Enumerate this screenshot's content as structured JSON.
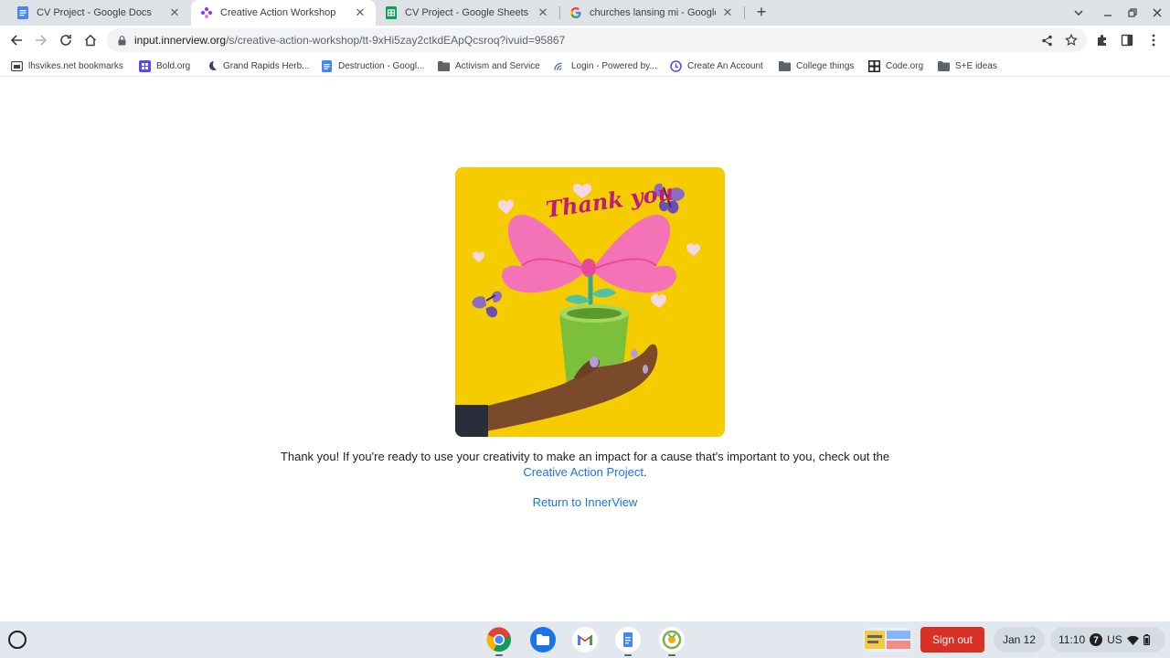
{
  "tabs": [
    {
      "title": "CV Project - Google Docs",
      "icon": "google-docs-icon"
    },
    {
      "title": "Creative Action Workshop",
      "icon": "innerview-icon",
      "active": true
    },
    {
      "title": "CV Project - Google Sheets",
      "icon": "google-sheets-icon"
    },
    {
      "title": "churches lansing mi - Google Se",
      "icon": "google-icon"
    }
  ],
  "address_bar": {
    "domain": "input.innerview.org",
    "path": "/s/creative-action-workshop/tt-9xHi5zay2ctkdEApQcsroq?ivuid=95867"
  },
  "bookmarks": [
    {
      "label": "lhsvikes.net bookmarks",
      "icon": "folder-icon"
    },
    {
      "label": "Bold.org",
      "icon": "bold-org-icon"
    },
    {
      "label": "Grand Rapids Herb...",
      "icon": "moon-icon"
    },
    {
      "label": "Destruction - Googl...",
      "icon": "google-docs-icon"
    },
    {
      "label": "Activism and Service",
      "icon": "folder-icon"
    },
    {
      "label": "Login - Powered by...",
      "icon": "signal-icon"
    },
    {
      "label": "Create An Account",
      "icon": "circle-logo-icon"
    },
    {
      "label": "College things",
      "icon": "folder-icon"
    },
    {
      "label": "Code.org",
      "icon": "code-org-icon"
    },
    {
      "label": "S+E ideas",
      "icon": "folder-icon"
    }
  ],
  "card": {
    "image_text": "Thank you"
  },
  "message": {
    "text_before": "Thank you! If you're ready to use your creativity to make an impact for a cause that's important to you, check out the ",
    "link_text": "Creative Action Project",
    "text_after": "."
  },
  "return_link": "Return to InnerView",
  "shelf": {
    "apps": [
      "chrome-icon",
      "files-icon",
      "gmail-icon",
      "google-docs-icon",
      "camera-app-icon"
    ],
    "sign_out": "Sign out",
    "date": "Jan 12",
    "time": "11:10",
    "notification_count": "7",
    "keyboard_layout": "US"
  },
  "colors": {
    "accent": "#1a73e8",
    "card_background": "#f4cc00",
    "sign_out": "#d93025"
  }
}
